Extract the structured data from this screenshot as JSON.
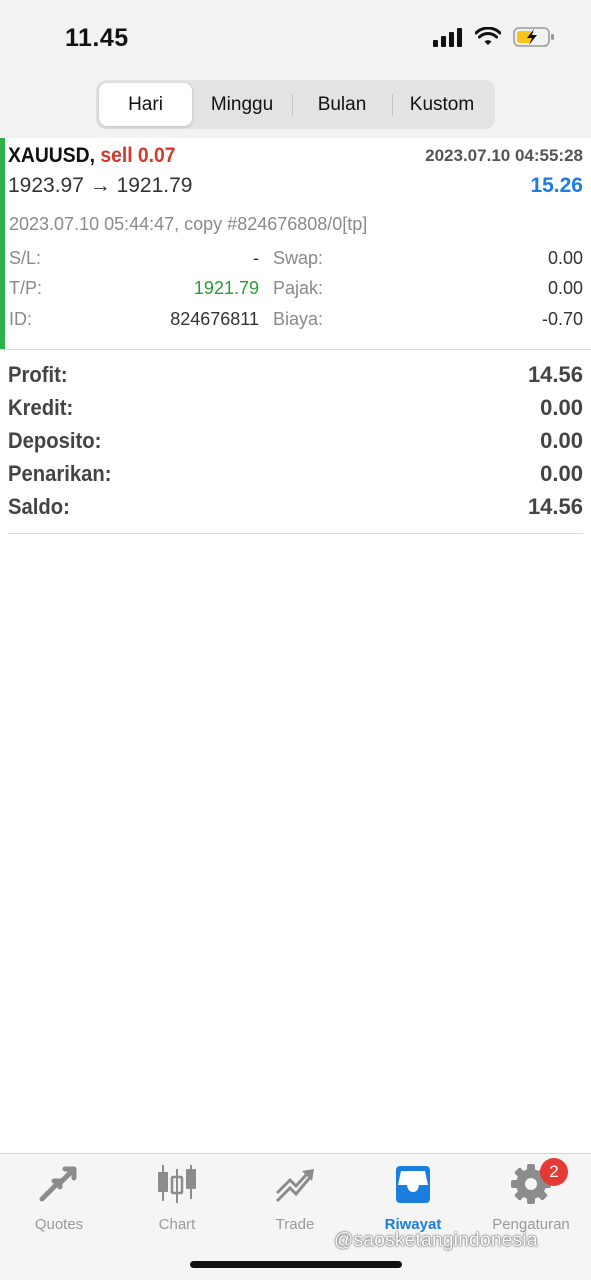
{
  "status": {
    "time": "11.45",
    "battery_color": "#f5c518"
  },
  "tabs": [
    {
      "label": "Hari",
      "active": true
    },
    {
      "label": "Minggu",
      "active": false
    },
    {
      "label": "Bulan",
      "active": false
    },
    {
      "label": "Kustom",
      "active": false
    }
  ],
  "deal": {
    "symbol": "XAUUSD,",
    "side": "sell 0.07",
    "open_time": "2023.07.10 04:55:28",
    "prices": "1923.97 → 1921.79",
    "profit": "15.26",
    "comment": "2023.07.10 05:44:47, copy #824676808/0[tp]",
    "left": [
      {
        "key": "S/L:",
        "value": "-"
      },
      {
        "key": "T/P:",
        "value": "1921.79"
      },
      {
        "key": "ID:",
        "value": "824676811"
      }
    ],
    "right": [
      {
        "key": "Swap:",
        "value": "0.00"
      },
      {
        "key": "Pajak:",
        "value": "0.00"
      },
      {
        "key": "Biaya:",
        "value": "-0.70"
      }
    ]
  },
  "summary": [
    {
      "key": "Profit:",
      "value": "14.56"
    },
    {
      "key": "Kredit:",
      "value": "0.00"
    },
    {
      "key": "Deposito:",
      "value": "0.00"
    },
    {
      "key": "Penarikan:",
      "value": "0.00"
    },
    {
      "key": "Saldo:",
      "value": "14.56"
    }
  ],
  "tabbar": {
    "items": [
      {
        "label": "Quotes",
        "icon": "quotes-arrows-icon"
      },
      {
        "label": "Chart",
        "icon": "candlestick-icon"
      },
      {
        "label": "Trade",
        "icon": "trade-trend-icon"
      },
      {
        "label": "Riwayat",
        "icon": "history-inbox-icon",
        "active": true
      },
      {
        "label": "Pengaturan",
        "icon": "gear-icon",
        "badge": "2"
      }
    ],
    "accent": "#1a7ee0"
  },
  "watermark": "@saosketangindonesia"
}
